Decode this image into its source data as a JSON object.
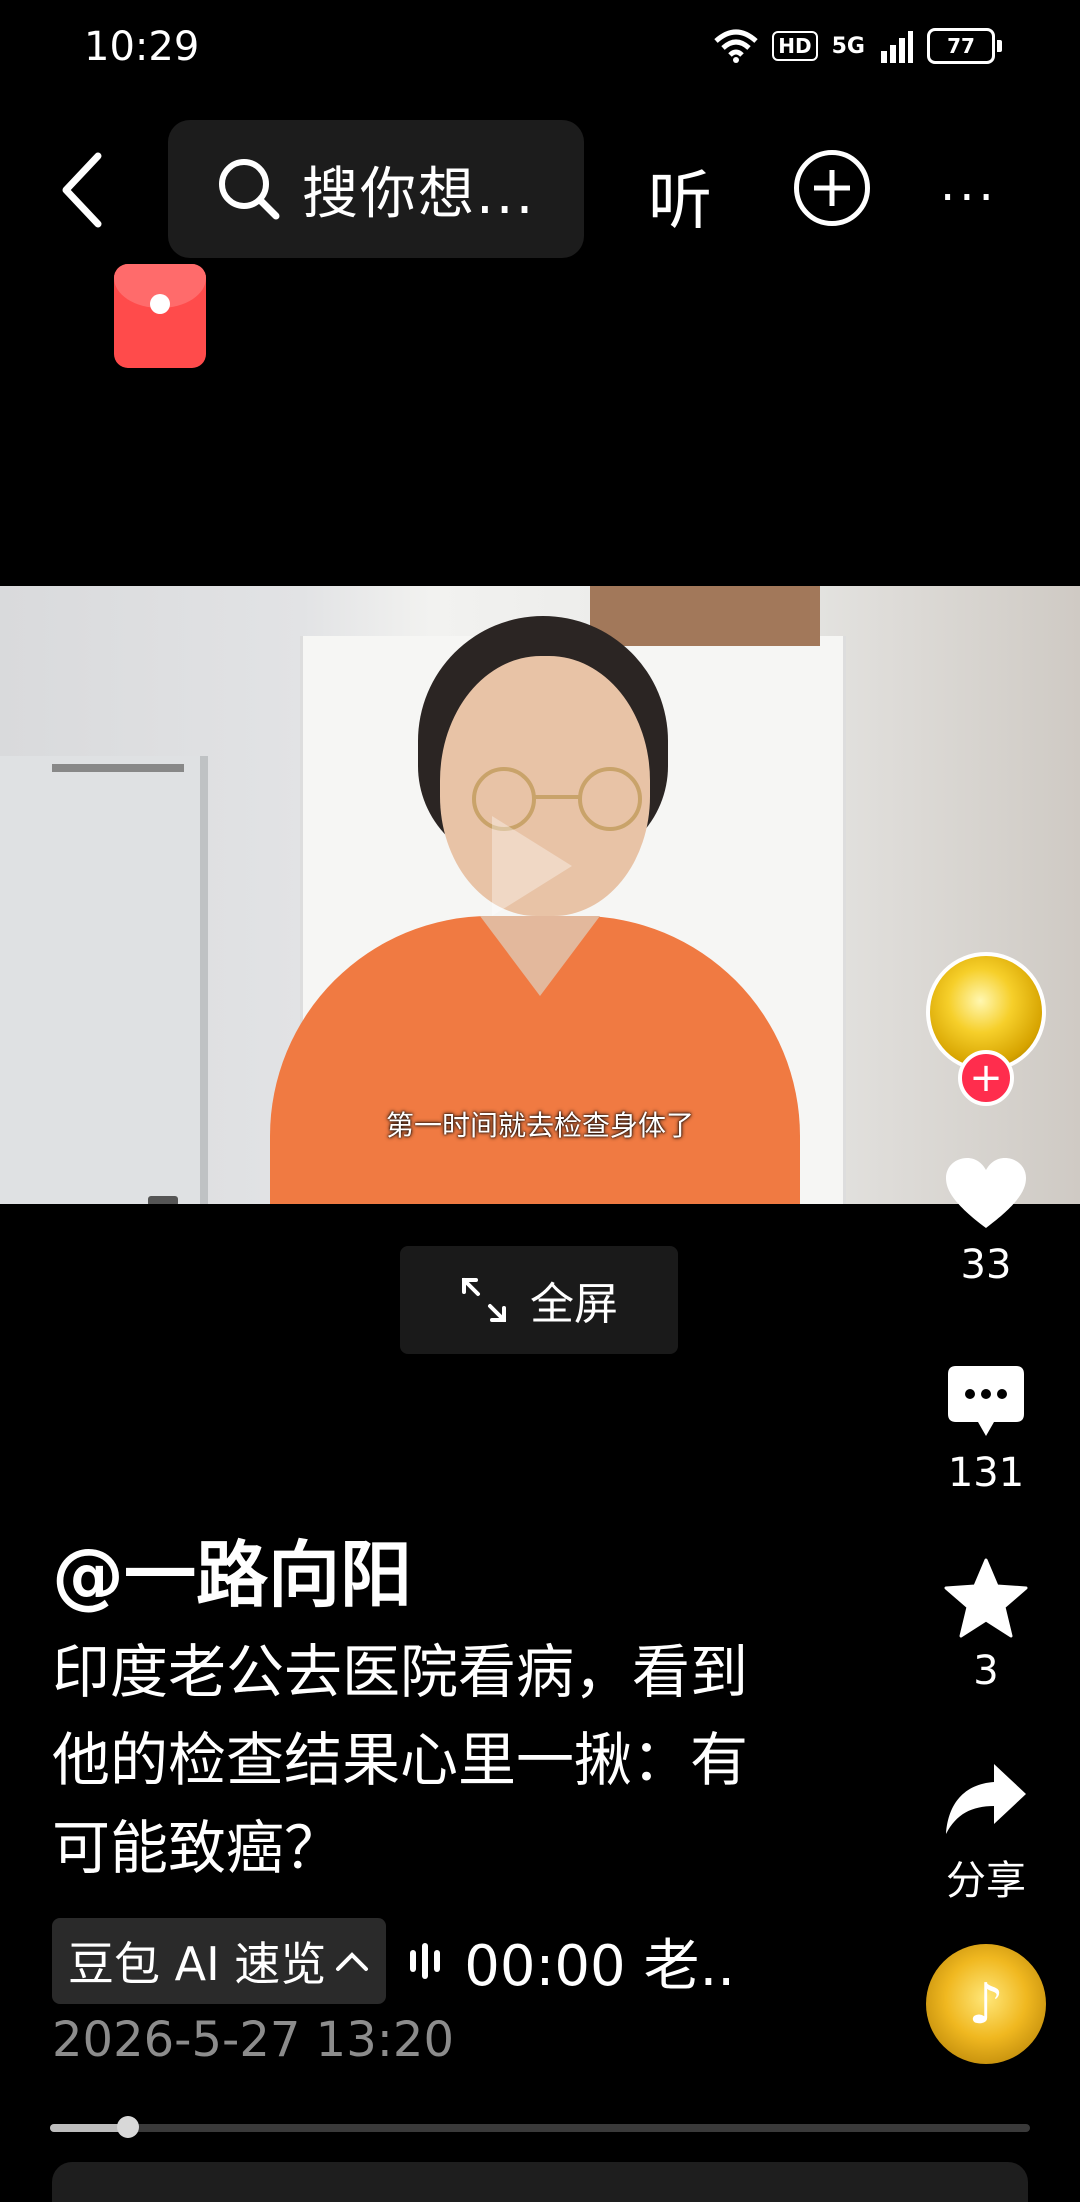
{
  "status_bar": {
    "time": "10:29",
    "hd": "HD",
    "network": "5G",
    "battery": "77"
  },
  "top_nav": {
    "search_placeholder": "搜你想...",
    "listen_label": "听"
  },
  "video": {
    "subtitle": "第一时间就去检查身体了"
  },
  "fullscreen_label": "全屏",
  "actions": {
    "likes": "33",
    "comments": "131",
    "favorites": "3",
    "share_label": "分享"
  },
  "post": {
    "author": "@一路向阳",
    "caption": "印度老公去医院看病，看到他的检查结果心里一揪：有可能致癌？",
    "ai_summary_label": "豆包 AI 速览",
    "summary_text": "00:00 老..",
    "date": "2026-5-27 13:20"
  },
  "progress": {
    "played_fraction": 0.08
  },
  "icons": {
    "back": "back-arrow-icon",
    "search": "search-icon",
    "add": "plus-circle-icon",
    "more": "more-icon",
    "like": "heart-icon",
    "comment": "comment-icon",
    "favorite": "star-icon",
    "share": "share-icon"
  },
  "colors": {
    "like_red": "#ff2d4d",
    "red_packet": "#ff4b4b"
  }
}
